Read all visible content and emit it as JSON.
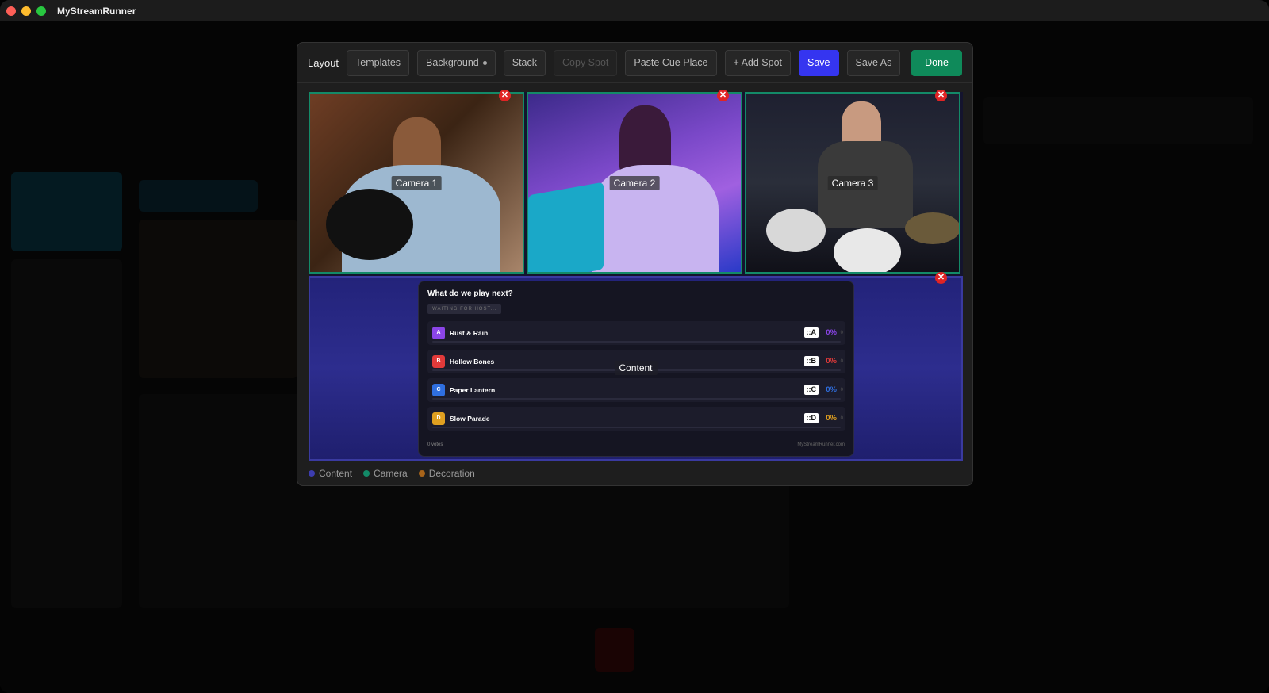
{
  "app": {
    "title": "MyStreamRunner"
  },
  "toolbar": {
    "layout_label": "Layout",
    "templates": "Templates",
    "background": "Background",
    "stack": "Stack",
    "copy_spot": "Copy Spot",
    "paste_cue_place": "Paste Cue Place",
    "add_spot": "+ Add Spot",
    "save": "Save",
    "save_as": "Save As",
    "done": "Done"
  },
  "cameras": [
    {
      "label": "Camera 1"
    },
    {
      "label": "Camera 2"
    },
    {
      "label": "Camera 3"
    }
  ],
  "content_spot": {
    "label": "Content",
    "poll": {
      "title": "What do we play next?",
      "status": "WAITING FOR HOST...",
      "options": [
        {
          "letter": "A",
          "name": "Rust & Rain",
          "code": "::A",
          "percent": "0%",
          "count": "0",
          "color": "#8b45e8"
        },
        {
          "letter": "B",
          "name": "Hollow Bones",
          "code": "::B",
          "percent": "0%",
          "count": "0",
          "color": "#e23a3a"
        },
        {
          "letter": "C",
          "name": "Paper Lantern",
          "code": "::C",
          "percent": "0%",
          "count": "0",
          "color": "#2f6fe0"
        },
        {
          "letter": "D",
          "name": "Slow Parade",
          "code": "::D",
          "percent": "0%",
          "count": "0",
          "color": "#e0a020"
        }
      ],
      "votes": "0 votes",
      "brand": "MyStreamRunner.com"
    }
  },
  "legend": [
    {
      "label": "Content",
      "color": "#3d3db0"
    },
    {
      "label": "Camera",
      "color": "#138a68"
    },
    {
      "label": "Decoration",
      "color": "#a8641a"
    }
  ],
  "colors": {
    "accent": "#3535f0",
    "done": "#0f8a5a",
    "close": "#e02424"
  }
}
